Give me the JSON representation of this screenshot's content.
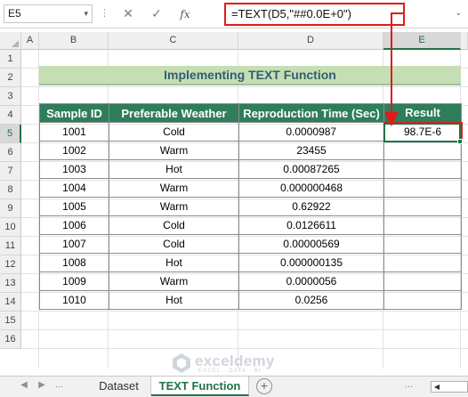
{
  "formula_bar": {
    "name_box": "E5",
    "separator": "⋮",
    "icons": [
      "cancel-icon",
      "enter-icon",
      "function-icon"
    ],
    "cancel_symbol": "✕",
    "enter_symbol": "✓",
    "fx_symbol": "fx",
    "formula": "=TEXT(D5,\"##0.0E+0\")",
    "expand_symbol": "⌄"
  },
  "columns": [
    "A",
    "B",
    "C",
    "D",
    "E"
  ],
  "rows": [
    "1",
    "2",
    "3",
    "4",
    "5",
    "6",
    "7",
    "8",
    "9",
    "10",
    "11",
    "12",
    "13",
    "14",
    "15",
    "16"
  ],
  "selected_cell": {
    "column": "E",
    "row": "5"
  },
  "title": "Implementing TEXT Function",
  "table": {
    "headers": [
      "Sample ID",
      "Preferable Weather",
      "Reproduction Time (Sec)",
      "Result"
    ],
    "rows": [
      [
        "1001",
        "Cold",
        "0.0000987",
        "98.7E-6"
      ],
      [
        "1002",
        "Warm",
        "23455",
        ""
      ],
      [
        "1003",
        "Hot",
        "0.00087265",
        ""
      ],
      [
        "1004",
        "Warm",
        "0.000000468",
        ""
      ],
      [
        "1005",
        "Warm",
        "0.62922",
        ""
      ],
      [
        "1006",
        "Cold",
        "0.0126611",
        ""
      ],
      [
        "1007",
        "Cold",
        "0.00000569",
        ""
      ],
      [
        "1008",
        "Hot",
        "0.000000135",
        ""
      ],
      [
        "1009",
        "Warm",
        "0.0000056",
        ""
      ],
      [
        "1010",
        "Hot",
        "0.0256",
        ""
      ]
    ]
  },
  "watermark": {
    "name": "exceldemy",
    "tagline": "EXCEL · DATA · BI"
  },
  "sheet_tabs": {
    "tabs": [
      "Dataset",
      "TEXT Function"
    ],
    "active": "TEXT Function",
    "prev_symbol": "◀",
    "next_symbol": "▶",
    "overflow_symbol": "...",
    "add_symbol": "+"
  },
  "colors": {
    "header_fill": "#2e7d5b",
    "title_fill": "#c6deb3",
    "title_text": "#2f5f74",
    "highlight": "#e01b1b",
    "excel_green": "#217346"
  }
}
